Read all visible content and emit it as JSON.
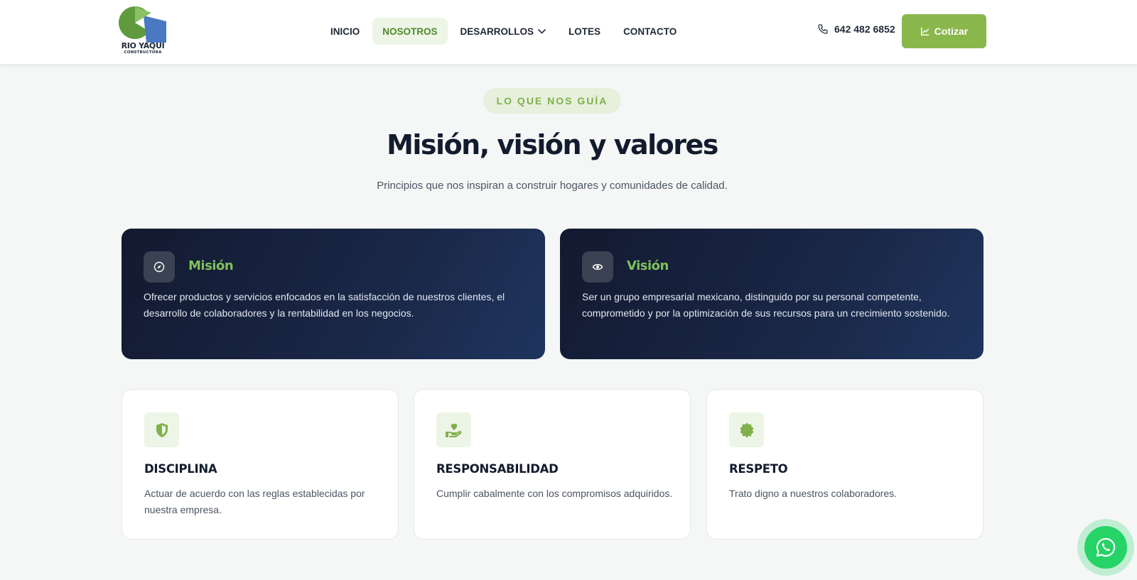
{
  "brand": {
    "name": "RIO YAQUI",
    "tagline": "CONSTRUCTORA"
  },
  "nav": {
    "items": [
      {
        "label": "INICIO"
      },
      {
        "label": "NOSOTROS",
        "active": true
      },
      {
        "label": "DESARROLLOS",
        "has_dropdown": true
      },
      {
        "label": "LOTES"
      },
      {
        "label": "CONTACTO"
      }
    ]
  },
  "header": {
    "phone": "642 482 6852",
    "cta_label": "Cotizar"
  },
  "section": {
    "eyebrow": "LO QUE NOS GUÍA",
    "title": "Misión, visión y valores",
    "subtitle": "Principios que nos inspiran a construir hogares y comunidades de calidad."
  },
  "mission": {
    "title": "Misión",
    "icon": "compass-icon",
    "text": "Ofrecer productos y servicios enfocados en la satisfacción de nuestros clientes, el desarrollo de colaboradores y la rentabilidad en los negocios."
  },
  "vision": {
    "title": "Visión",
    "icon": "eye-icon",
    "text": "Ser un grupo empresarial mexicano, distinguido por su personal competente, comprometido y por la optimización de sus recursos para un crecimiento sostenido."
  },
  "values": [
    {
      "title": "DISCIPLINA",
      "icon": "shield-icon",
      "text": "Actuar de acuerdo con las reglas establecidas por nuestra empresa."
    },
    {
      "title": "RESPONSABILIDAD",
      "icon": "hand-heart-icon",
      "text": "Cumplir cabalmente con los compromisos adquiridos."
    },
    {
      "title": "RESPETO",
      "icon": "badge-icon",
      "text": "Trato digno a nuestros colaboradores."
    }
  ],
  "colors": {
    "brand_green": "#8ab74b",
    "accent_green": "#7ec05a",
    "navy": "#131b2e",
    "whatsapp": "#25d366"
  }
}
